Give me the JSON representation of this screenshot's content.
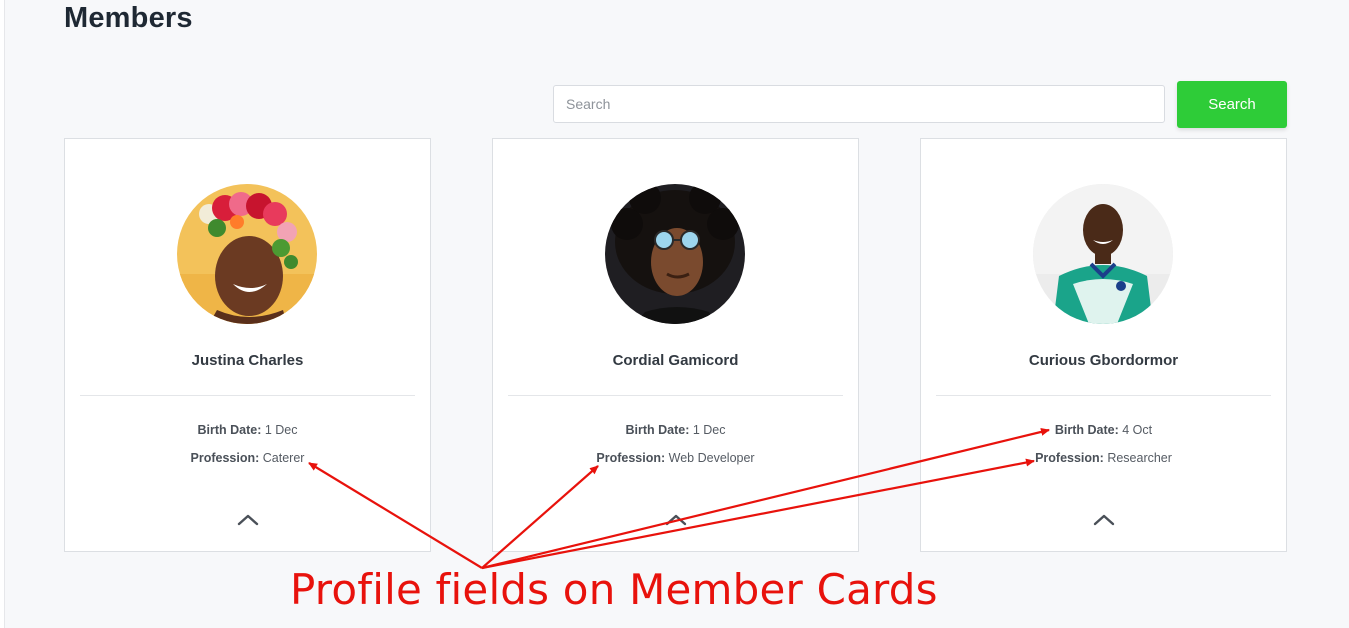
{
  "page": {
    "title": "Members"
  },
  "search": {
    "placeholder": "Search",
    "button_label": "Search",
    "button_color": "#2ecc38"
  },
  "members": [
    {
      "name": "Justina Charles",
      "birth_label": "Birth Date:",
      "birth_value": "1 Dec",
      "profession_label": "Profession:",
      "profession_value": "Caterer",
      "avatar_background": "#f3c25a"
    },
    {
      "name": "Cordial Gamicord",
      "birth_label": "Birth Date:",
      "birth_value": "1 Dec",
      "profession_label": "Profession:",
      "profession_value": "Web Developer",
      "avatar_background": "#1f1e22"
    },
    {
      "name": "Curious Gbordormor",
      "birth_label": "Birth Date:",
      "birth_value": "4 Oct",
      "profession_label": "Profession:",
      "profession_value": "Researcher",
      "avatar_background": "#eeeeee"
    }
  ],
  "annotation": {
    "text": "Profile fields on Member Cards",
    "color": "#e8120c"
  },
  "icons": {
    "card_toggle": "chevron-up-icon"
  }
}
